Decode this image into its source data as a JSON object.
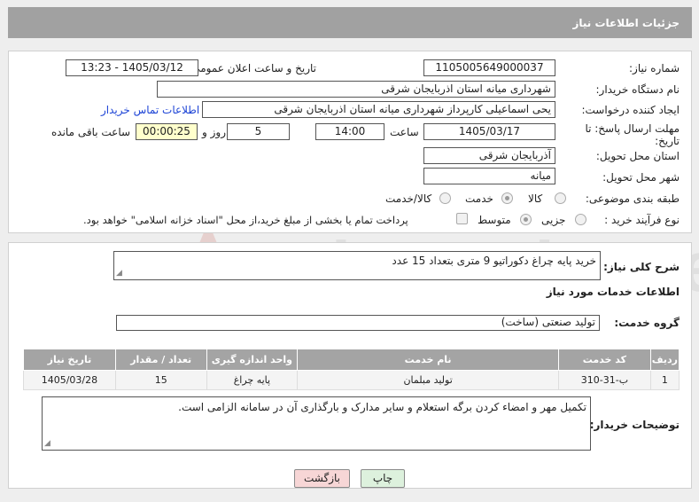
{
  "header": {
    "title": "جزئیات اطلاعات نیاز"
  },
  "form": {
    "need_number_label": "شماره نیاز:",
    "need_number": "1105005649000037",
    "announce_label": "تاریخ و ساعت اعلان عمومی:",
    "announce_value": "1405/03/12 - 13:23",
    "buyer_org_label": "نام دستگاه خریدار:",
    "buyer_org": "شهرداری میانه استان اذربایجان شرقی",
    "creator_label": "ایجاد کننده درخواست:",
    "creator": "یحی اسماعیلی  کارپرداز شهرداری میانه استان اذربایجان شرقی",
    "contact_link": "اطلاعات تماس خریدار",
    "deadline_label_1": "مهلت ارسال پاسخ: تا",
    "deadline_label_2": "تاریخ:",
    "deadline_date": "1405/03/17",
    "time_label": "ساعت",
    "deadline_time": "14:00",
    "days_value": "5",
    "days_label": "روز و",
    "remaining_value": "00:00:25",
    "remaining_label": "ساعت باقی مانده",
    "province_label": "استان محل تحویل:",
    "province": "آذربایجان شرقی",
    "city_label": "شهر محل تحویل:",
    "city": "میانه",
    "category_label": "طبقه بندی موضوعی:",
    "category_options": [
      "کالا",
      "خدمت",
      "کالا/خدمت"
    ],
    "category_selected": "خدمت",
    "process_label": "نوع فرآیند خرید :",
    "process_options": [
      "جزیی",
      "متوسط"
    ],
    "process_selected": "جزیی",
    "payment_note": "پرداخت تمام یا بخشی از مبلغ خرید،از محل \"اسناد خزانه اسلامی\" خواهد بود."
  },
  "summary": {
    "label": "شرح کلی نیاز:",
    "value": "خرید پایه چراغ دکوراتیو 9 متری بتعداد 15 عدد",
    "services_title": "اطلاعات خدمات مورد نیاز",
    "group_label": "گروه خدمت:",
    "group_value": "تولید صنعتی (ساخت)"
  },
  "table": {
    "headers": [
      "ردیف",
      "کد خدمت",
      "نام خدمت",
      "واحد اندازه گیری",
      "تعداد / مقدار",
      "تاریخ نیاز"
    ],
    "rows": [
      [
        "1",
        "ب-31-310",
        "تولید مبلمان",
        "پایه چراغ",
        "15",
        "1405/03/28"
      ]
    ]
  },
  "notes": {
    "label": "توضیحات خریدار:",
    "value": "تکمیل مهر و امضاء کردن برگه استعلام و سایر مدارک و بارگذاری آن در سامانه الزامی است."
  },
  "buttons": {
    "print": "چاپ",
    "back": "بازگشت"
  },
  "watermark": {
    "text": "AriaTender.net"
  },
  "colors": {
    "header_bg": "#a1a1a1",
    "link": "#1d44d6",
    "remaining_bg": "#ffffcc",
    "back_btn_bg": "#f7d6d6",
    "print_btn_bg": "#ddf1dd"
  }
}
